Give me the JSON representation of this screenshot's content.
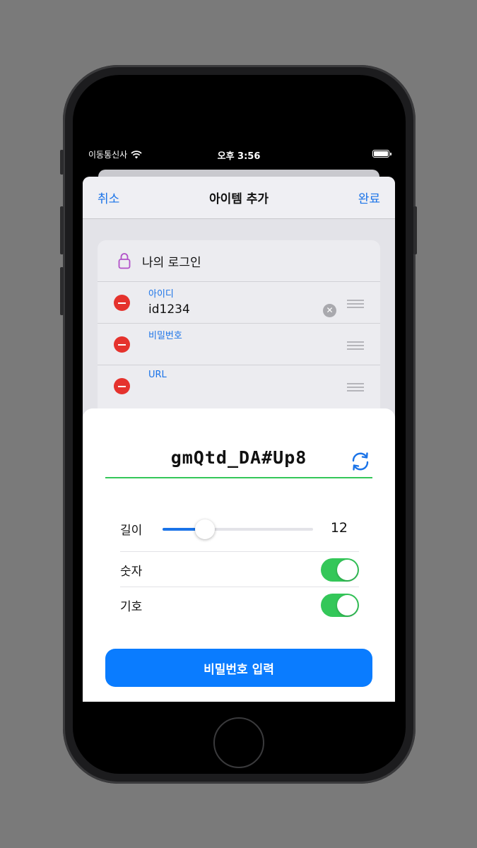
{
  "status_bar": {
    "carrier": "이동통신사",
    "time": "오후 3:56"
  },
  "nav": {
    "cancel": "취소",
    "title": "아이템 추가",
    "done": "완료"
  },
  "item": {
    "name": "나의 로그인",
    "fields": [
      {
        "label": "아이디",
        "value": "id1234"
      },
      {
        "label": "비밀번호",
        "value": ""
      },
      {
        "label": "URL",
        "value": ""
      }
    ]
  },
  "generator": {
    "password": "gmQtd_DA#Up8",
    "length_label": "길이",
    "length_value": "12",
    "length_fraction": 0.28,
    "numbers_label": "숫자",
    "numbers_on": true,
    "symbols_label": "기호",
    "symbols_on": true,
    "submit": "비밀번호 입력"
  },
  "colors": {
    "accent": "#1a73e8",
    "button": "#0a7cff",
    "success": "#34c759",
    "destructive": "#e5322d"
  }
}
